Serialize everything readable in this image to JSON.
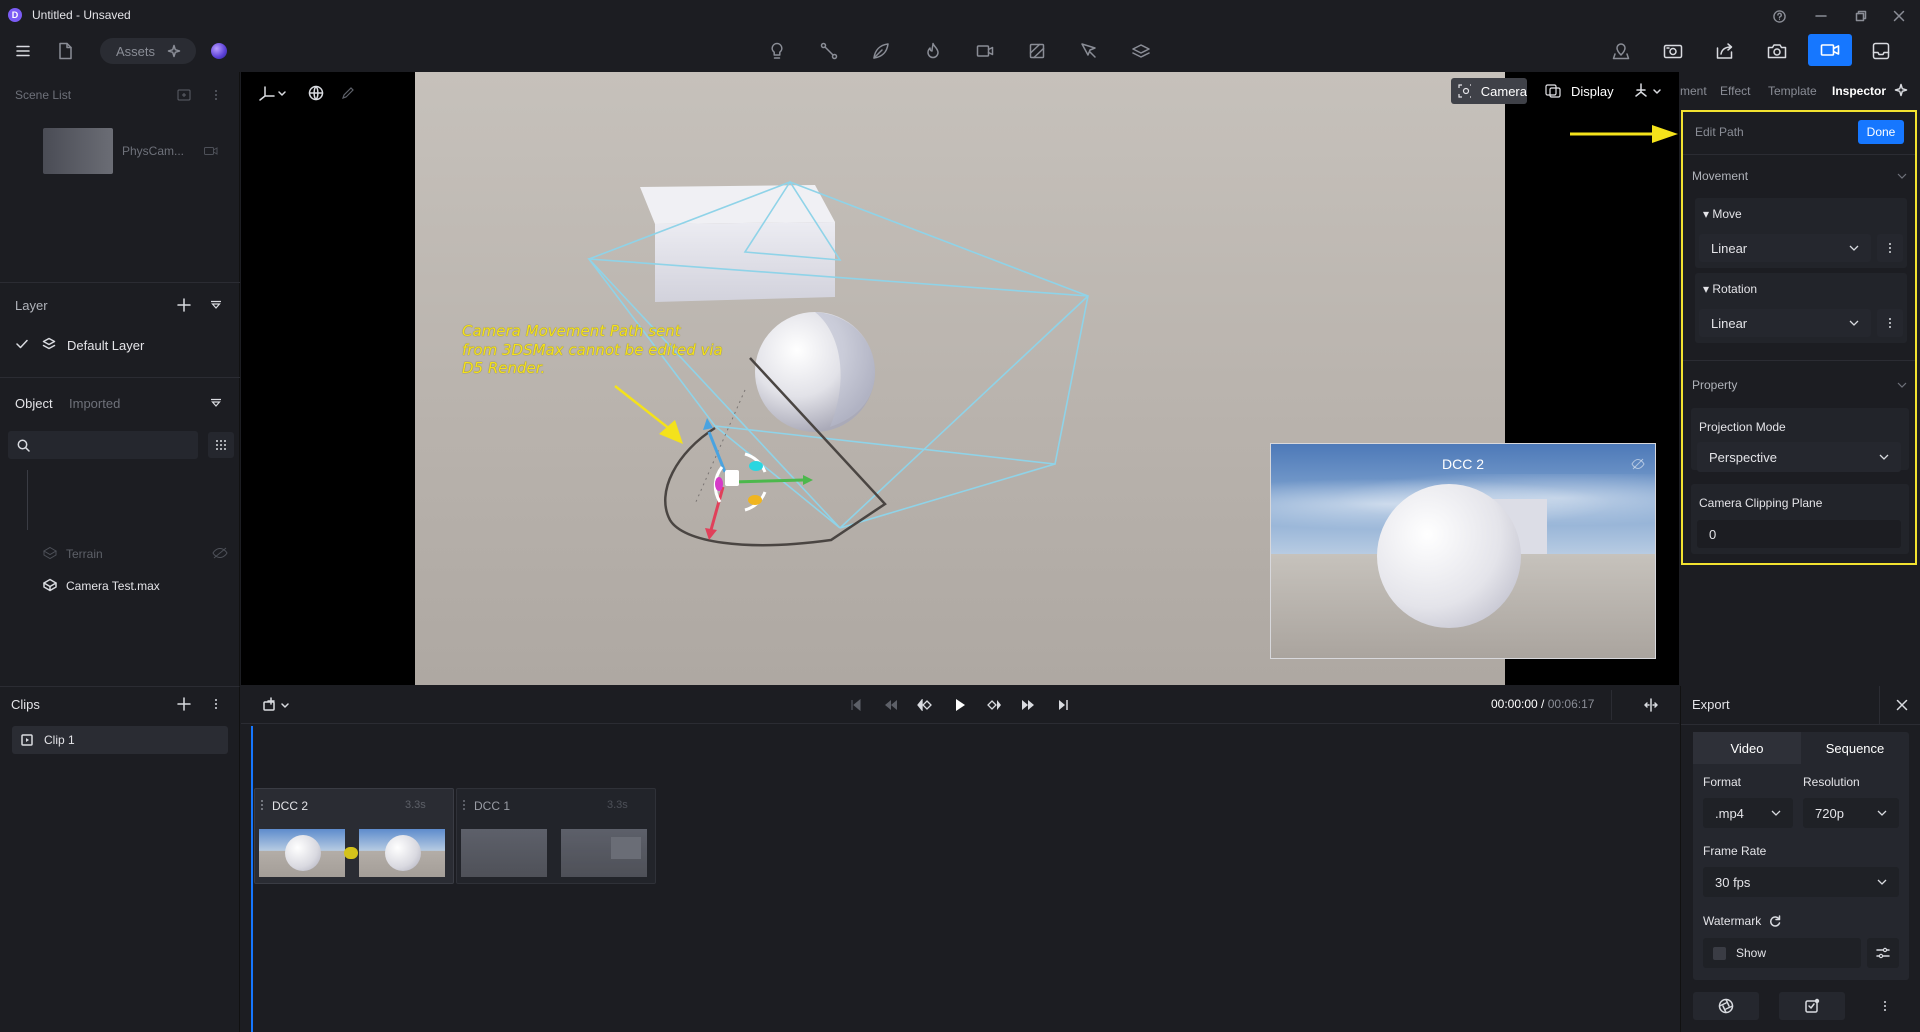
{
  "window": {
    "title": "Untitled - Unsaved"
  },
  "toolbar": {
    "assets_label": "Assets"
  },
  "scene_list": {
    "title": "Scene List",
    "item_label": "PhysCam..."
  },
  "layer": {
    "title": "Layer",
    "default_layer": "Default Layer"
  },
  "objects": {
    "tab_object": "Object",
    "tab_imported": "Imported",
    "search_placeholder": "",
    "items": [
      "Terrain",
      "Camera Test.max"
    ]
  },
  "clips": {
    "title": "Clips",
    "items": [
      "Clip 1"
    ]
  },
  "viewport": {
    "camera_label": "Camera",
    "display_label": "Display",
    "annotation": [
      "Camera Movement Path sent",
      "from 3DSMax cannot be edited via",
      "D5 Render."
    ],
    "preview_title": "DCC 2",
    "colors": {
      "annotation": "#f4e21b",
      "frustum": "#8fd3e8"
    }
  },
  "inspector": {
    "tabs": [
      "ment",
      "Effect",
      "Template",
      "Inspector"
    ],
    "active_tab": "Inspector",
    "edit_path_label": "Edit Path",
    "done_label": "Done",
    "movement": {
      "title": "Movement",
      "move_label": "Move",
      "move_value": "Linear",
      "rotation_label": "Rotation",
      "rotation_value": "Linear"
    },
    "property": {
      "title": "Property",
      "projection_label": "Projection Mode",
      "projection_value": "Perspective",
      "clipping_label": "Camera Clipping Plane",
      "clipping_value": "0"
    },
    "colors": {
      "highlight": "#f2e230",
      "done": "#1677ff"
    }
  },
  "timeline": {
    "current_time": "00:00:00",
    "separator": " / ",
    "total_time": "00:06:17",
    "tracks": [
      {
        "name": "DCC 2",
        "duration": "3.3s"
      },
      {
        "name": "DCC 1",
        "duration": "3.3s"
      }
    ]
  },
  "export": {
    "title": "Export",
    "tab_video": "Video",
    "tab_sequence": "Sequence",
    "format_label": "Format",
    "format_value": ".mp4",
    "resolution_label": "Resolution",
    "resolution_value": "720p",
    "framerate_label": "Frame Rate",
    "framerate_value": "30 fps",
    "watermark_label": "Watermark",
    "show_label": "Show"
  }
}
